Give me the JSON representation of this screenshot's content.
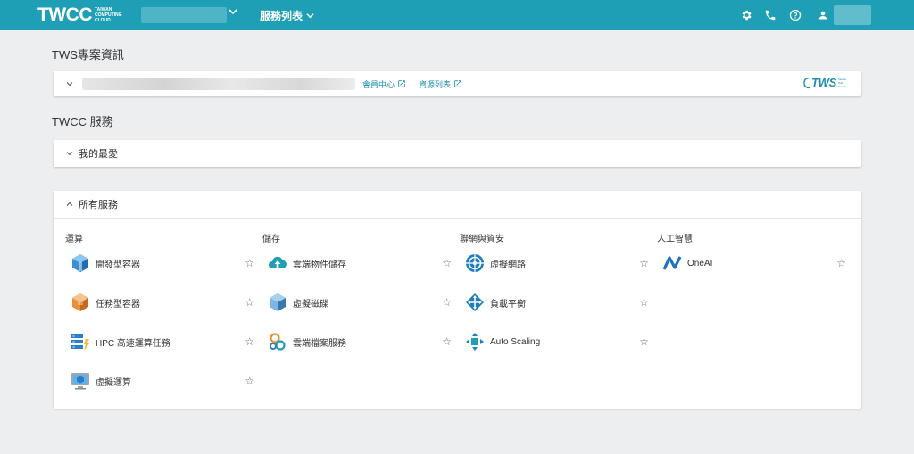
{
  "topbar": {
    "logo": "TWCC",
    "logo_sub": [
      "TAIWAN",
      "COMPUTING",
      "CLOUD"
    ],
    "services_menu": "服務列表"
  },
  "project_section": {
    "title": "TWS專案資訊",
    "links": [
      "會員中心",
      "資源列表"
    ],
    "tws_logo": "TWS",
    "tws_logo_sub": [
      "Taiwan",
      "Web",
      "Service"
    ]
  },
  "twcc_section": {
    "title": "TWCC 服務",
    "favorites": "我的最愛",
    "all_services": "所有服務"
  },
  "categories": [
    {
      "name": "運算",
      "items": [
        {
          "label": "開發型容器",
          "icon": "container-cube-icon"
        },
        {
          "label": "任務型容器",
          "icon": "task-cube-icon"
        },
        {
          "label": "HPC 高速運算任務",
          "icon": "hpc-server-icon"
        },
        {
          "label": "虛擬運算",
          "icon": "monitor-icon"
        }
      ]
    },
    {
      "name": "儲存",
      "items": [
        {
          "label": "雲端物件儲存",
          "icon": "cloud-upload-icon"
        },
        {
          "label": "虛擬磁碟",
          "icon": "disk-cube-icon"
        },
        {
          "label": "雲端檔案服務",
          "icon": "file-service-icon"
        }
      ]
    },
    {
      "name": "聯網與資安",
      "items": [
        {
          "label": "虛擬網路",
          "icon": "network-globe-icon"
        },
        {
          "label": "負載平衡",
          "icon": "load-balancer-icon"
        },
        {
          "label": "Auto Scaling",
          "icon": "auto-scaling-icon"
        }
      ]
    },
    {
      "name": "人工智慧",
      "items": [
        {
          "label": "OneAI",
          "icon": "oneai-icon"
        }
      ]
    }
  ],
  "colors": {
    "brand": "#1e9fb5",
    "link": "#1e8fb0",
    "background": "#eceef0"
  }
}
